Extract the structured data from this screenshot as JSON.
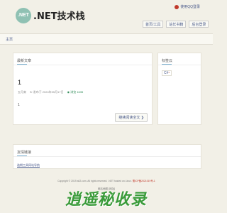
{
  "header": {
    "logo_badge": ".NET",
    "site_title": ".NET技术栈",
    "login_label": "使用QQ登录",
    "nav": [
      "首页/工具",
      "站长书籍",
      "后台登录"
    ]
  },
  "breadcrumb": {
    "home": "主页"
  },
  "latest": {
    "title": "最新文章",
    "article": {
      "title": "1",
      "author": "五月来",
      "date": "① 发布于 2024年05月17日",
      "views": "◉ 浏览 1635",
      "excerpt": "1",
      "read_more": "继续阅读全文 ❯"
    }
  },
  "tags": {
    "title": "标签云",
    "items": [
      {
        "label": "C#",
        "count": "1"
      }
    ]
  },
  "friends": {
    "title": "友情链接",
    "link": "逾期工具网站导航"
  },
  "footer": {
    "copyright": "Copyright © 2019 a02.com. All rights reserved. .NET hosted on Linux.",
    "icp": "蜀ICP备2021019号-1",
    "sub": "网站地图 [网址]"
  },
  "watermark": "逍遥秘收录"
}
